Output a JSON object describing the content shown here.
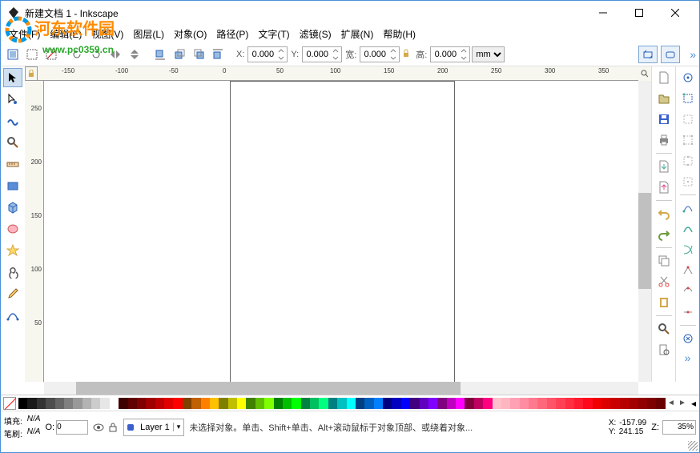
{
  "title": "新建文档 1 - Inkscape",
  "watermark": {
    "text": "河东软件园",
    "url": "www.pc0359.cn"
  },
  "menu": {
    "file": "文件(F)",
    "edit": "编辑(E)",
    "view": "视图(V)",
    "layer": "图层(L)",
    "object": "对象(O)",
    "path": "路径(P)",
    "text": "文字(T)",
    "filter": "滤镜(S)",
    "ext": "扩展(N)",
    "help": "帮助(H)"
  },
  "toolbar": {
    "x_label": "X:",
    "x_val": "0.000",
    "y_label": "Y:",
    "y_val": "0.000",
    "w_label": "宽:",
    "w_val": "0.000",
    "h_label": "高:",
    "h_val": "0.000",
    "unit": "mm"
  },
  "hruler_ticks": [
    "-150",
    "-100",
    "-50",
    "0",
    "50",
    "100",
    "150",
    "200",
    "250",
    "300",
    "350"
  ],
  "vruler_ticks": [
    "250",
    "200",
    "150",
    "100",
    "50"
  ],
  "status": {
    "fill_label": "填充:",
    "fill_val": "N/A",
    "stroke_label": "笔刷:",
    "stroke_val": "N/A",
    "o_label": "O:",
    "o_val": "0",
    "layer_name": "Layer 1",
    "message": "未选择对象。单击、Shift+单击、Alt+滚动鼠标于对象顶部、或绕着对象...",
    "x_label": "X:",
    "x_val": "-157.99",
    "y_label": "Y:",
    "y_val": "241.15",
    "z_label": "Z:",
    "z_val": "35%"
  },
  "colors": [
    "#000000",
    "#1a1a1a",
    "#333333",
    "#4d4d4d",
    "#666666",
    "#808080",
    "#999999",
    "#b3b3b3",
    "#cccccc",
    "#e6e6e6",
    "#ffffff",
    "#400000",
    "#600000",
    "#800000",
    "#a00000",
    "#c00000",
    "#e00000",
    "#ff0000",
    "#804000",
    "#c06000",
    "#ff8000",
    "#ffc000",
    "#808000",
    "#c0c000",
    "#ffff00",
    "#408000",
    "#60c000",
    "#80ff00",
    "#008000",
    "#00c000",
    "#00ff00",
    "#008040",
    "#00c060",
    "#00ff80",
    "#008080",
    "#00c0c0",
    "#00ffff",
    "#004080",
    "#0060c0",
    "#0080ff",
    "#000080",
    "#0000c0",
    "#0000ff",
    "#400080",
    "#6000c0",
    "#8000ff",
    "#800080",
    "#c000c0",
    "#ff00ff",
    "#800040",
    "#c00060",
    "#ff0080",
    "#ffc0cb",
    "#ffb6c1",
    "#ffa0b4",
    "#ff8da1",
    "#ff7a8e",
    "#ff677b",
    "#ff5468",
    "#ff4155",
    "#ff2e42",
    "#ff1b2f",
    "#ff081c",
    "#f00000",
    "#dd0000",
    "#ca0000",
    "#b70000",
    "#a40000",
    "#910000",
    "#7e0000",
    "#6b0000"
  ]
}
